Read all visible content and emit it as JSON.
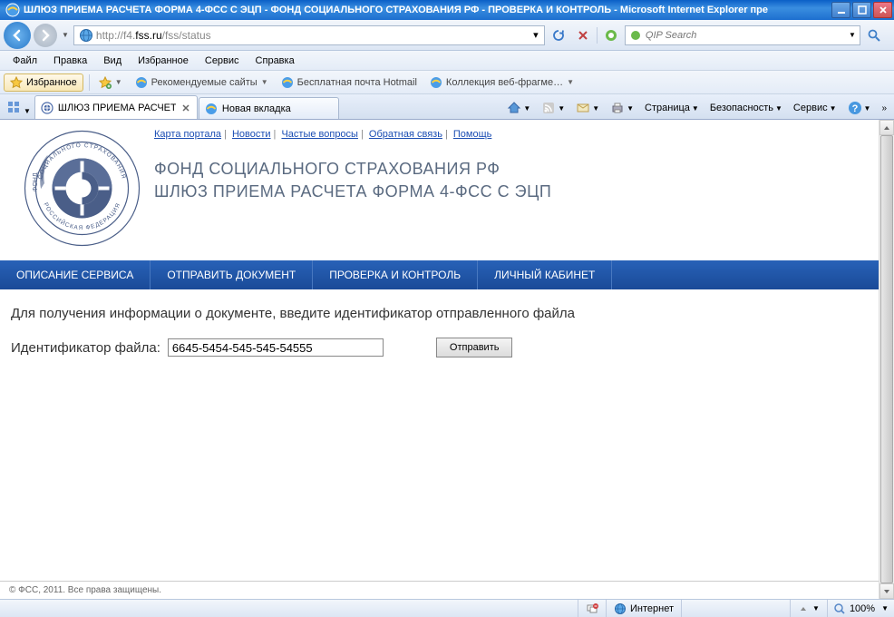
{
  "window": {
    "title": "ШЛЮЗ ПРИЕМА РАСЧЕТА ФОРМА 4-ФСС С ЭЦП - ФОНД СОЦИАЛЬНОГО СТРАХОВАНИЯ РФ - ПРОВЕРКА И КОНТРОЛЬ - Microsoft Internet Explorer пре"
  },
  "url": {
    "prefix": "http://f4.",
    "host": "fss.ru",
    "path": "/fss/status"
  },
  "search": {
    "placeholder": "QIP Search"
  },
  "menu": {
    "file": "Файл",
    "edit": "Правка",
    "view": "Вид",
    "favorites": "Избранное",
    "tools": "Сервис",
    "help": "Справка"
  },
  "favbar": {
    "favorites": "Избранное",
    "recommended": "Рекомендуемые сайты",
    "hotmail": "Бесплатная почта Hotmail",
    "fragments": "Коллекция веб-фрагме…"
  },
  "tabs": {
    "active": "ШЛЮЗ ПРИЕМА РАСЧЕТ...",
    "new": "Новая вкладка"
  },
  "tabtools": {
    "page": "Страница",
    "safety": "Безопасность",
    "service": "Сервис"
  },
  "page": {
    "toplinks": [
      "Карта портала",
      "Новости",
      "Частые вопросы",
      "Обратная связь",
      "Помощь"
    ],
    "title1": "ФОНД СОЦИАЛЬНОГО СТРАХОВАНИЯ РФ",
    "title2": "ШЛЮЗ ПРИЕМА РАСЧЕТА ФОРМА 4-ФСС С ЭЦП",
    "nav": [
      "ОПИСАНИЕ СЕРВИСА",
      "ОТПРАВИТЬ ДОКУМЕНТ",
      "ПРОВЕРКА И КОНТРОЛЬ",
      "ЛИЧНЫЙ КАБИНЕТ"
    ],
    "instruction": "Для получения информации о документе, введите идентификатор отправленного файла",
    "label": "Идентификатор файла:",
    "input_value": "6645-5454-545-545-54555",
    "submit": "Отправить",
    "footer": "© ФСС, 2011. Все права защищены."
  },
  "status": {
    "zone": "Интернет",
    "zoom": "100%"
  }
}
